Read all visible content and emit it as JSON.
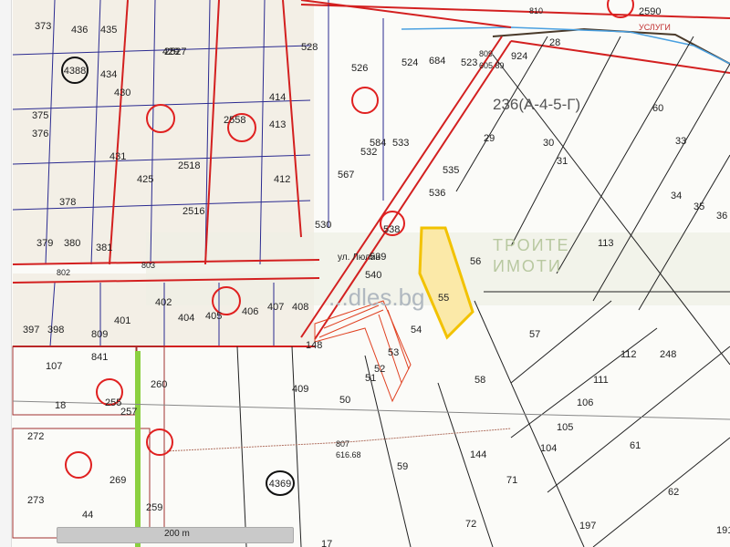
{
  "map": {
    "street_name": "ул. Люлин",
    "zone_label": "236(А-4-5-Г)",
    "watermark": {
      "line1": "ТРОИТЕ",
      "line2": "ИМОТИ",
      "site": "...dles.bg"
    },
    "service_label": "УСЛУГИ",
    "scale_label": "200 m",
    "circled_ids": [
      "4388",
      "4369"
    ],
    "elevations": [
      {
        "id": "809",
        "value": "605.89"
      },
      {
        "id": "807",
        "value": "616.68"
      },
      {
        "id": "810",
        "value": "810"
      },
      {
        "id": "802",
        "value": "802"
      },
      {
        "id": "803",
        "value": "803"
      },
      {
        "id": "2590",
        "value": "2590"
      }
    ],
    "parcels": [
      "436",
      "435",
      "373",
      "375",
      "376",
      "378",
      "379",
      "380",
      "381",
      "434",
      "431",
      "430",
      "429",
      "2527",
      "2518",
      "425",
      "2516",
      "2558",
      "413",
      "412",
      "414",
      "584",
      "528",
      "526",
      "524",
      "684",
      "523",
      "532",
      "533",
      "535",
      "536",
      "530",
      "567",
      "540",
      "539",
      "538",
      "397",
      "398",
      "809",
      "401",
      "402",
      "404",
      "405",
      "406",
      "407",
      "408",
      "107",
      "18",
      "841",
      "255",
      "257",
      "272",
      "273",
      "44",
      "269",
      "260",
      "259",
      "148",
      "409",
      "50",
      "51",
      "52",
      "53",
      "54",
      "55",
      "56",
      "57",
      "58",
      "59",
      "29",
      "30",
      "31",
      "33",
      "34",
      "35",
      "36",
      "60",
      "113",
      "112",
      "248",
      "111",
      "106",
      "105",
      "104",
      "144",
      "71",
      "72",
      "61",
      "62",
      "197",
      "191",
      "17",
      "28",
      "924"
    ],
    "highlight_color": "#f2c200",
    "line_color": "#d32020"
  }
}
